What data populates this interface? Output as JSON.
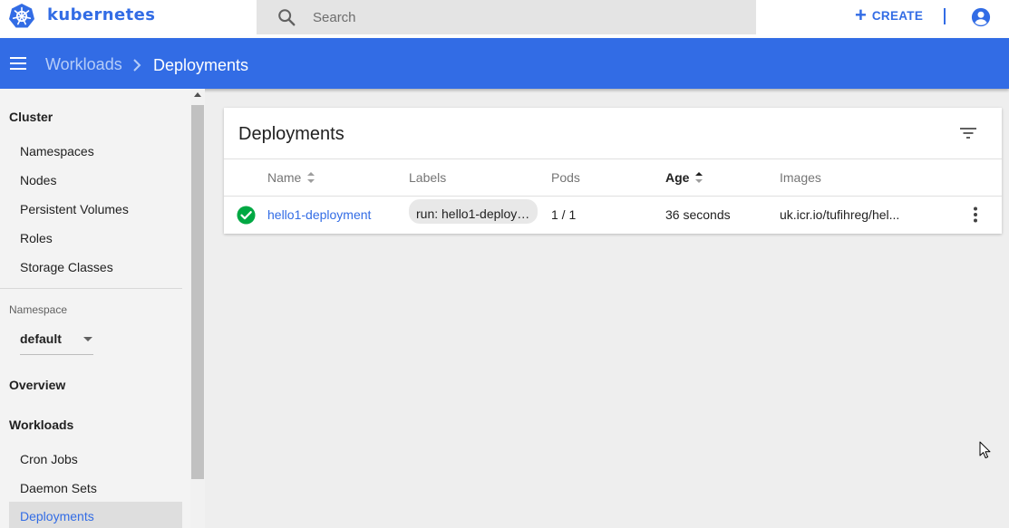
{
  "app": {
    "brand": "kubernetes"
  },
  "search": {
    "placeholder": "Search"
  },
  "header": {
    "create_label": "CREATE"
  },
  "breadcrumb": {
    "parent": "Workloads",
    "current": "Deployments"
  },
  "sidebar": {
    "cluster_heading": "Cluster",
    "cluster_items": [
      {
        "label": "Namespaces"
      },
      {
        "label": "Nodes"
      },
      {
        "label": "Persistent Volumes"
      },
      {
        "label": "Roles"
      },
      {
        "label": "Storage Classes"
      }
    ],
    "namespace_label": "Namespace",
    "namespace_value": "default",
    "overview_heading": "Overview",
    "workloads_heading": "Workloads",
    "workload_items": [
      {
        "label": "Cron Jobs"
      },
      {
        "label": "Daemon Sets"
      },
      {
        "label": "Deployments",
        "active": true
      }
    ]
  },
  "card": {
    "title": "Deployments",
    "columns": {
      "name": "Name",
      "labels": "Labels",
      "pods": "Pods",
      "age": "Age",
      "images": "Images"
    },
    "rows": [
      {
        "status": "ok",
        "name": "hello1-deployment",
        "label": "run: hello1-deploym...",
        "pods": "1 / 1",
        "age": "36 seconds",
        "image": "uk.icr.io/tufihreg/hel..."
      }
    ]
  },
  "colors": {
    "accent": "#326ce5",
    "success": "#00a843",
    "sidebar_bg": "#f3f3f3",
    "page_bg": "#eeeeee"
  },
  "icons": [
    "kubernetes-logo",
    "search-icon",
    "plus-icon",
    "account-icon",
    "menu-icon",
    "chevron-right-icon",
    "filter-icon",
    "sort-icon",
    "check-circle-icon",
    "more-vert-icon",
    "mouse-cursor-icon"
  ]
}
